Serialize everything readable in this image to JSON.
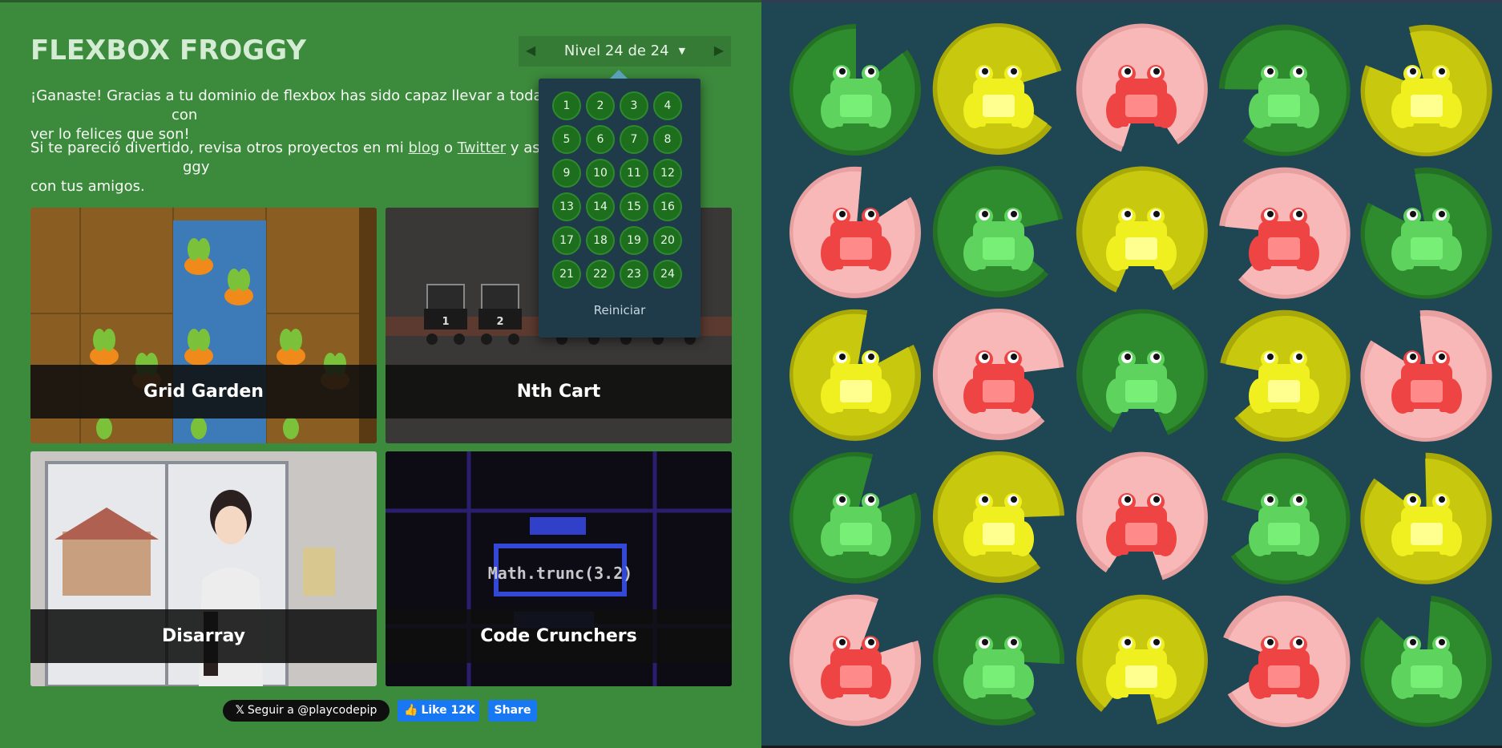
{
  "header": {
    "title": "FLEXBOX FROGGY"
  },
  "level_nav": {
    "label": "Nivel 24 de 24",
    "prev": "◀",
    "next": "▶",
    "caret": "▼"
  },
  "dropdown": {
    "levels": [
      "1",
      "2",
      "3",
      "4",
      "5",
      "6",
      "7",
      "8",
      "9",
      "10",
      "11",
      "12",
      "13",
      "14",
      "15",
      "16",
      "17",
      "18",
      "19",
      "20",
      "21",
      "22",
      "23",
      "24"
    ],
    "reset_label": "Reiniciar"
  },
  "intro": {
    "p1_before": "¡Ganaste! Gracias a tu dominio de flexbox has sido capaz llevar a todas las ranas",
    "p1_after": "con",
    "p1_line2": "ver lo felices que son!",
    "p2_before": "Si te pareció divertido, revisa otros proyectos en mi",
    "blog_link": "blog",
    "p2_or": "o",
    "twitter_link": "Twitter",
    "p2_after": "y asegúrate d",
    "p2_trail": "ggy",
    "p2_line2": "con tus amigos."
  },
  "games": [
    {
      "name": "Grid Garden"
    },
    {
      "name": "Nth Cart"
    },
    {
      "name": "Disarray"
    },
    {
      "name": "Code Crunchers"
    }
  ],
  "game_art": {
    "cart_labels": [
      "1",
      "2"
    ],
    "code_text": "Math.trunc(3.2)"
  },
  "social": {
    "twitter_follow": "Seguir a @playcodepip",
    "fb_like": "Like 12K",
    "fb_share": "Share"
  },
  "board": {
    "colors": {
      "green": "#3aa33a",
      "yellow": "#d4d416",
      "red": "#f6b7b7"
    },
    "rows": [
      [
        "green",
        "yellow",
        "red",
        "green",
        "yellow"
      ],
      [
        "red",
        "green",
        "yellow",
        "red",
        "green"
      ],
      [
        "yellow",
        "red",
        "green",
        "yellow",
        "red"
      ],
      [
        "green",
        "yellow",
        "red",
        "green",
        "yellow"
      ],
      [
        "red",
        "green",
        "yellow",
        "red",
        "green"
      ]
    ]
  }
}
